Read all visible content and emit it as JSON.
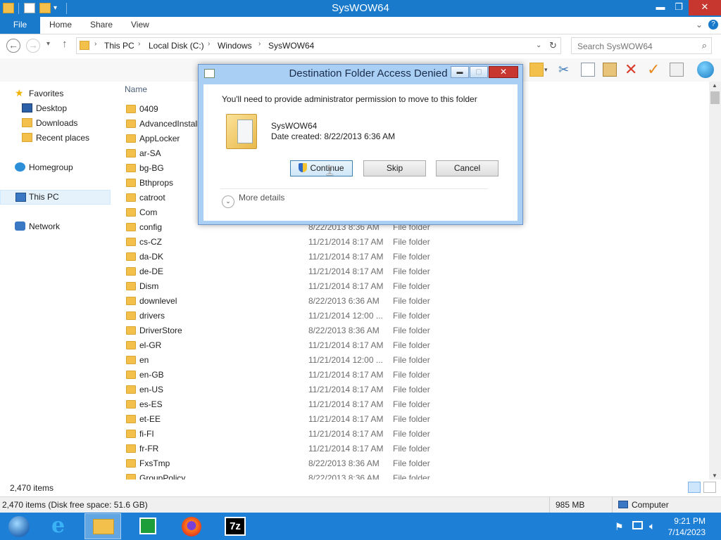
{
  "window": {
    "title": "SysWOW64",
    "minimize": "▬",
    "maximize": "❐",
    "close": "✕"
  },
  "ribbon": {
    "file": "File",
    "tabs": [
      "Home",
      "Share",
      "View"
    ],
    "collapse": "⌄",
    "help": "?"
  },
  "address": {
    "crumbs": [
      "This PC",
      "Local Disk (C:)",
      "Windows",
      "SysWOW64"
    ],
    "search_placeholder": "Search SysWOW64"
  },
  "navpane": {
    "items": [
      {
        "label": "Favorites",
        "icon": "star-icon"
      },
      {
        "label": "Desktop",
        "icon": "desktop-icon"
      },
      {
        "label": "Downloads",
        "icon": "downloads-icon"
      },
      {
        "label": "Recent places",
        "icon": "recent-places-icon"
      },
      {
        "label": "Homegroup",
        "icon": "homegroup-icon"
      },
      {
        "label": "This PC",
        "icon": "computer-icon"
      },
      {
        "label": "Network",
        "icon": "network-icon"
      }
    ]
  },
  "list": {
    "column_name": "Name",
    "rows": [
      {
        "name": "0409",
        "date": "",
        "type": ""
      },
      {
        "name": "AdvancedInstall",
        "date": "",
        "type": ""
      },
      {
        "name": "AppLocker",
        "date": "",
        "type": ""
      },
      {
        "name": "ar-SA",
        "date": "",
        "type": ""
      },
      {
        "name": "bg-BG",
        "date": "",
        "type": ""
      },
      {
        "name": "Bthprops",
        "date": "",
        "type": ""
      },
      {
        "name": "catroot",
        "date": "",
        "type": ""
      },
      {
        "name": "Com",
        "date": "",
        "type": ""
      },
      {
        "name": "config",
        "date": "8/22/2013 8:36 AM",
        "type": "File folder"
      },
      {
        "name": "cs-CZ",
        "date": "11/21/2014 8:17 AM",
        "type": "File folder"
      },
      {
        "name": "da-DK",
        "date": "11/21/2014 8:17 AM",
        "type": "File folder"
      },
      {
        "name": "de-DE",
        "date": "11/21/2014 8:17 AM",
        "type": "File folder"
      },
      {
        "name": "Dism",
        "date": "11/21/2014 8:17 AM",
        "type": "File folder"
      },
      {
        "name": "downlevel",
        "date": "8/22/2013 6:36 AM",
        "type": "File folder"
      },
      {
        "name": "drivers",
        "date": "11/21/2014 12:00 ...",
        "type": "File folder"
      },
      {
        "name": "DriverStore",
        "date": "8/22/2013 8:36 AM",
        "type": "File folder"
      },
      {
        "name": "el-GR",
        "date": "11/21/2014 8:17 AM",
        "type": "File folder"
      },
      {
        "name": "en",
        "date": "11/21/2014 12:00 ...",
        "type": "File folder"
      },
      {
        "name": "en-GB",
        "date": "11/21/2014 8:17 AM",
        "type": "File folder"
      },
      {
        "name": "en-US",
        "date": "11/21/2014 8:17 AM",
        "type": "File folder"
      },
      {
        "name": "es-ES",
        "date": "11/21/2014 8:17 AM",
        "type": "File folder"
      },
      {
        "name": "et-EE",
        "date": "11/21/2014 8:17 AM",
        "type": "File folder"
      },
      {
        "name": "fi-FI",
        "date": "11/21/2014 8:17 AM",
        "type": "File folder"
      },
      {
        "name": "fr-FR",
        "date": "11/21/2014 8:17 AM",
        "type": "File folder"
      },
      {
        "name": "FxsTmp",
        "date": "8/22/2013 8:36 AM",
        "type": "File folder"
      },
      {
        "name": "GroupPolicy",
        "date": "8/22/2013 8:36 AM",
        "type": "File folder"
      }
    ]
  },
  "status": {
    "items": "2,470 items",
    "detail": "2,470 items (Disk free space: 51.6 GB)",
    "size": "985 MB",
    "location": "Computer"
  },
  "dialog": {
    "title": "Destination Folder Access Denied",
    "message": "You'll need to provide administrator permission to move to this folder",
    "folder_name": "SysWOW64",
    "date_created": "Date created: 8/22/2013 6:36 AM",
    "continue": "Continue",
    "skip": "Skip",
    "cancel": "Cancel",
    "more_details": "More details"
  },
  "taskbar": {
    "apps": [
      "start-button",
      "internet-explorer-icon",
      "file-explorer-icon",
      "store-icon",
      "firefox-icon",
      "7zip-icon"
    ],
    "zip_label": "7z",
    "time": "9:21 PM",
    "date": "7/14/2023"
  },
  "colors": {
    "accent": "#1979ca",
    "taskbar": "#1d7fd6",
    "dialog_frame": "#a9cff4"
  }
}
